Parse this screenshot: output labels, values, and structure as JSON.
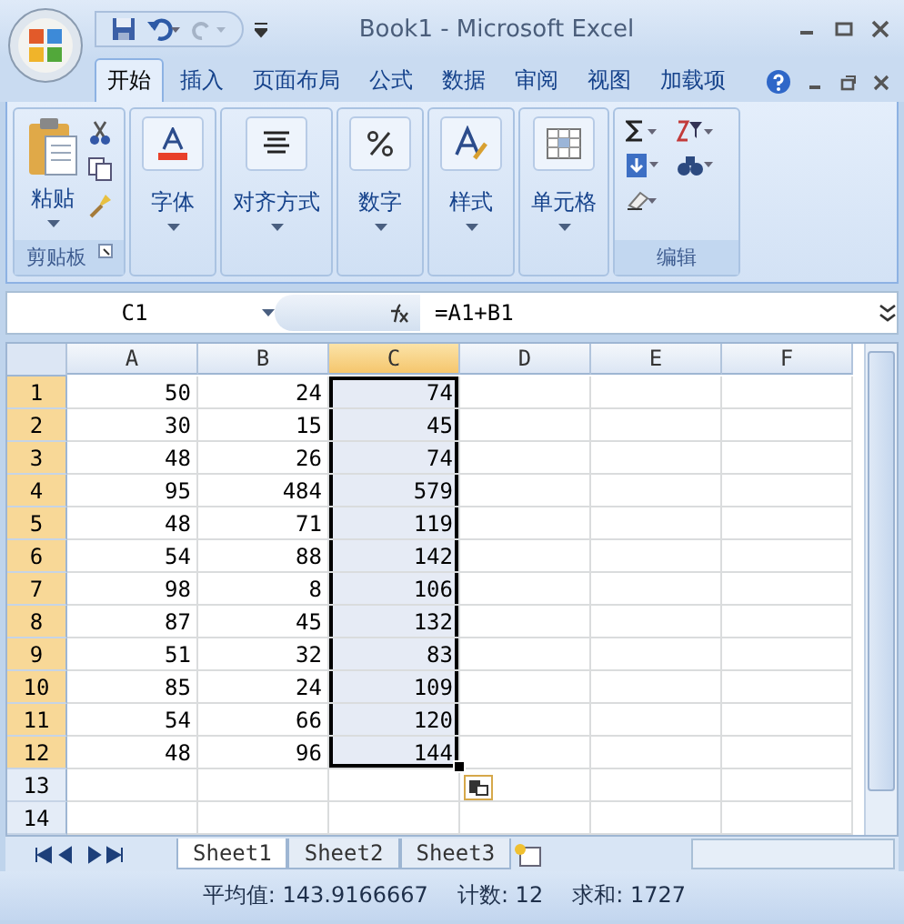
{
  "window": {
    "title": "Book1 - Microsoft Excel"
  },
  "tabs": [
    {
      "label": "开始",
      "selected": true
    },
    {
      "label": "插入",
      "selected": false
    },
    {
      "label": "页面布局",
      "selected": false
    },
    {
      "label": "公式",
      "selected": false
    },
    {
      "label": "数据",
      "selected": false
    },
    {
      "label": "审阅",
      "selected": false
    },
    {
      "label": "视图",
      "selected": false
    },
    {
      "label": "加载项",
      "selected": false
    }
  ],
  "ribbon_groups": [
    {
      "kind": "clipboard",
      "button": "粘贴",
      "name": "剪贴板"
    },
    {
      "kind": "font",
      "button": "字体"
    },
    {
      "kind": "align",
      "button": "对齐方式"
    },
    {
      "kind": "number",
      "button": "数字"
    },
    {
      "kind": "style",
      "button": "样式"
    },
    {
      "kind": "cells",
      "button": "单元格"
    },
    {
      "kind": "editing",
      "name": "编辑"
    }
  ],
  "formula_bar": {
    "name_box": "C1",
    "formula": "=A1+B1"
  },
  "columns": [
    {
      "label": "A",
      "selected": false
    },
    {
      "label": "B",
      "selected": false
    },
    {
      "label": "C",
      "selected": true
    },
    {
      "label": "D",
      "selected": false
    },
    {
      "label": "E",
      "selected": false
    },
    {
      "label": "F",
      "selected": false
    }
  ],
  "rows": [
    {
      "number": "1",
      "selected": true,
      "cells": [
        "50",
        "24",
        "74"
      ]
    },
    {
      "number": "2",
      "selected": true,
      "cells": [
        "30",
        "15",
        "45"
      ]
    },
    {
      "number": "3",
      "selected": true,
      "cells": [
        "48",
        "26",
        "74"
      ]
    },
    {
      "number": "4",
      "selected": true,
      "cells": [
        "95",
        "484",
        "579"
      ]
    },
    {
      "number": "5",
      "selected": true,
      "cells": [
        "48",
        "71",
        "119"
      ]
    },
    {
      "number": "6",
      "selected": true,
      "cells": [
        "54",
        "88",
        "142"
      ]
    },
    {
      "number": "7",
      "selected": true,
      "cells": [
        "98",
        "8",
        "106"
      ]
    },
    {
      "number": "8",
      "selected": true,
      "cells": [
        "87",
        "45",
        "132"
      ]
    },
    {
      "number": "9",
      "selected": true,
      "cells": [
        "51",
        "32",
        "83"
      ]
    },
    {
      "number": "10",
      "selected": true,
      "cells": [
        "85",
        "24",
        "109"
      ]
    },
    {
      "number": "11",
      "selected": true,
      "cells": [
        "54",
        "66",
        "120"
      ]
    },
    {
      "number": "12",
      "selected": true,
      "cells": [
        "48",
        "96",
        "144"
      ]
    },
    {
      "number": "13",
      "selected": false,
      "cells": []
    },
    {
      "number": "14",
      "selected": false,
      "cells": []
    }
  ],
  "sheets": [
    {
      "label": "Sheet1",
      "selected": true
    },
    {
      "label": "Sheet2",
      "selected": false
    },
    {
      "label": "Sheet3",
      "selected": false
    }
  ],
  "status_bar": {
    "average": "平均值: 143.9166667",
    "count": "计数: 12",
    "sum": "求和: 1727"
  }
}
